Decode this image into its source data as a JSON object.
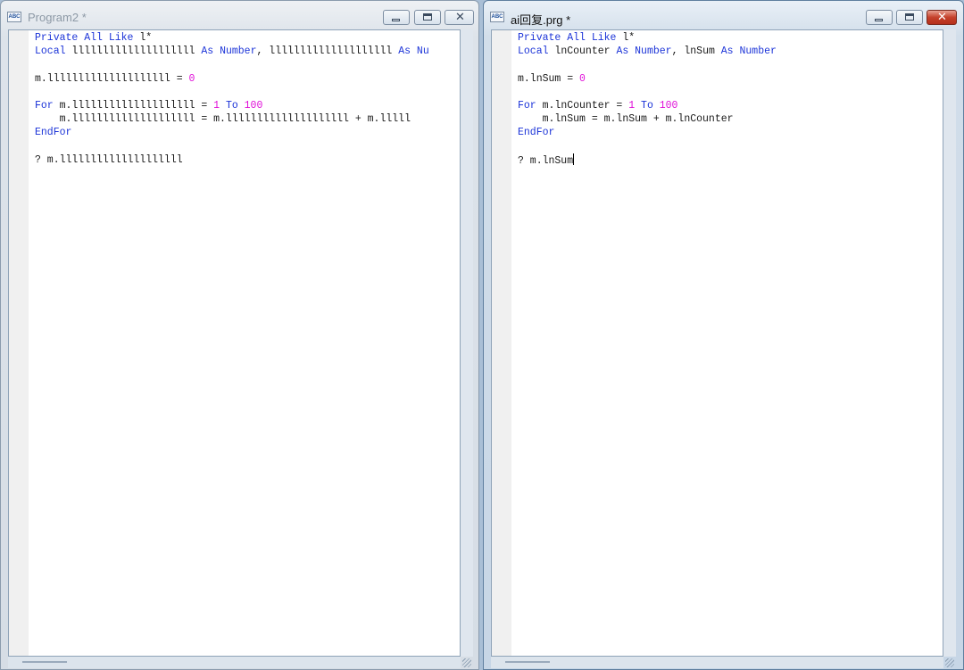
{
  "windows": [
    {
      "title": "Program2 *",
      "icon": "abc-document-icon",
      "active": false,
      "lines": [
        [
          {
            "t": "Private All Like ",
            "c": "kw"
          },
          {
            "t": "l*",
            "c": "plain"
          }
        ],
        [
          {
            "t": "Local ",
            "c": "kw"
          },
          {
            "t": "llllllllllllllllllll ",
            "c": "plain"
          },
          {
            "t": "As Number",
            "c": "kw"
          },
          {
            "t": ", llllllllllllllllllll ",
            "c": "plain"
          },
          {
            "t": "As Nu",
            "c": "kw"
          }
        ],
        [],
        [
          {
            "t": "m.llllllllllllllllllll = ",
            "c": "plain"
          },
          {
            "t": "0",
            "c": "num"
          }
        ],
        [],
        [
          {
            "t": "For ",
            "c": "kw"
          },
          {
            "t": "m.llllllllllllllllllll = ",
            "c": "plain"
          },
          {
            "t": "1",
            "c": "num"
          },
          {
            "t": " To ",
            "c": "kw"
          },
          {
            "t": "100",
            "c": "num"
          }
        ],
        [
          {
            "t": "    m.llllllllllllllllllll = m.llllllllllllllllllll + m.lllll",
            "c": "plain"
          }
        ],
        [
          {
            "t": "EndFor",
            "c": "kw"
          }
        ],
        [],
        [
          {
            "t": "? m.llllllllllllllllllll",
            "c": "plain"
          }
        ]
      ]
    },
    {
      "title": "ai回复.prg *",
      "icon": "abc-document-icon",
      "active": true,
      "lines": [
        [
          {
            "t": "Private All Like ",
            "c": "kw"
          },
          {
            "t": "l*",
            "c": "plain"
          }
        ],
        [
          {
            "t": "Local ",
            "c": "kw"
          },
          {
            "t": "lnCounter ",
            "c": "plain"
          },
          {
            "t": "As Number",
            "c": "kw"
          },
          {
            "t": ", lnSum ",
            "c": "plain"
          },
          {
            "t": "As Number",
            "c": "kw"
          }
        ],
        [],
        [
          {
            "t": "m.lnSum = ",
            "c": "plain"
          },
          {
            "t": "0",
            "c": "num"
          }
        ],
        [],
        [
          {
            "t": "For ",
            "c": "kw"
          },
          {
            "t": "m.lnCounter = ",
            "c": "plain"
          },
          {
            "t": "1",
            "c": "num"
          },
          {
            "t": " To ",
            "c": "kw"
          },
          {
            "t": "100",
            "c": "num"
          }
        ],
        [
          {
            "t": "    m.lnSum = m.lnSum + m.lnCounter",
            "c": "plain"
          }
        ],
        [
          {
            "t": "EndFor",
            "c": "kw"
          }
        ],
        [],
        [
          {
            "t": "? m.lnSum",
            "c": "plain"
          },
          {
            "t": "",
            "c": "cursor"
          }
        ]
      ]
    }
  ],
  "buttons": {
    "minimize": "minimize-icon",
    "maximize": "restore-icon",
    "close": "close-icon",
    "close_glyph": "✕"
  },
  "colors": {
    "keyword": "#1c34d8",
    "number": "#e010d8",
    "text": "#1a1a1a",
    "close_active": "#c4402a"
  }
}
